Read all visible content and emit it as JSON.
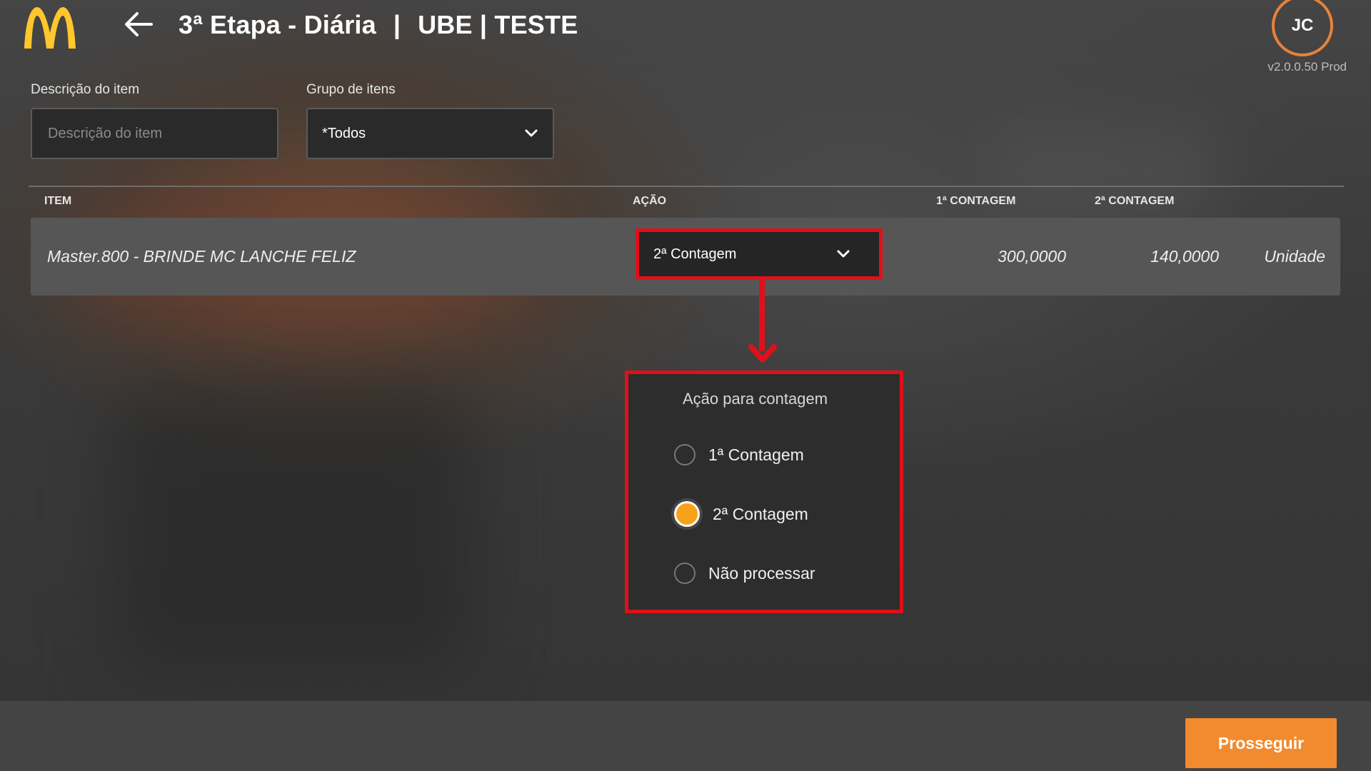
{
  "header": {
    "title": "3ª Etapa - Diária",
    "separator": "|",
    "store": "UBE | TESTE",
    "avatar_initials": "JC",
    "version": "v2.0.0.50 Prod"
  },
  "filters": {
    "description_label": "Descrição do item",
    "description_placeholder": "Descrição do item",
    "description_value": "",
    "group_label": "Grupo de itens",
    "group_value": "*Todos"
  },
  "table": {
    "columns": [
      "ITEM",
      "AÇÃO",
      "1ª CONTAGEM",
      "2ª CONTAGEM"
    ],
    "rows": [
      {
        "item": "Master.800 - BRINDE MC LANCHE FELIZ",
        "action": "2ª Contagem",
        "count1": "300,0000",
        "count2": "140,0000",
        "unit": "Unidade"
      }
    ]
  },
  "popup": {
    "title": "Ação para contagem",
    "options": [
      "1ª Contagem",
      "2ª Contagem",
      "Não processar"
    ],
    "selected": "2ª Contagem"
  },
  "footer": {
    "proceed_label": "Prosseguir"
  },
  "colors": {
    "brand_yellow": "#FFC72C",
    "accent_orange": "#F28A2E",
    "highlight_red": "#E0101A"
  }
}
